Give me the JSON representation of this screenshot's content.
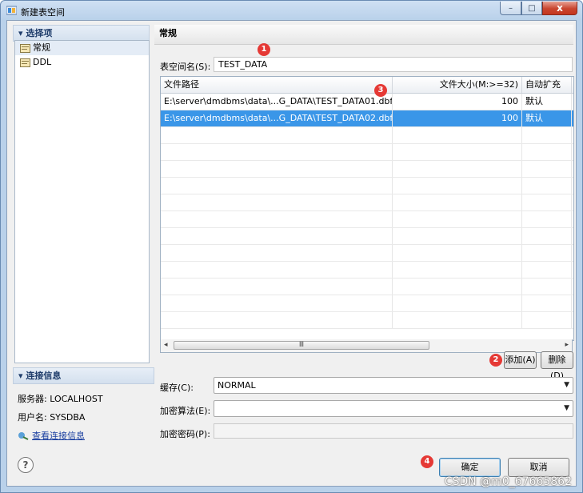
{
  "window": {
    "title": "新建表空间",
    "minimize": "–",
    "maximize": "□",
    "close": "x"
  },
  "left": {
    "options_header": "选择项",
    "tree": [
      {
        "label": "常规"
      },
      {
        "label": "DDL"
      }
    ],
    "conn_header": "连接信息",
    "server": "服务器: LOCALHOST",
    "user": "用户名: SYSDBA",
    "view_link": "查看连接信息"
  },
  "right": {
    "header": "常规",
    "tablespace_label": "表空间名(S):",
    "tablespace_value": "TEST_DATA",
    "table": {
      "columns": [
        "文件路径",
        "文件大小(M:>=32)",
        "自动扩充"
      ],
      "rows": [
        [
          "E:\\server\\dmdbms\\data\\...G_DATA\\TEST_DATA01.dbf",
          "100",
          "默认"
        ],
        [
          "E:\\server\\dmdbms\\data\\...G_DATA\\TEST_DATA02.dbf",
          "100",
          "默认"
        ]
      ],
      "selected_row": 1
    },
    "add_button": "添加(A)",
    "delete_button": "删除(D)",
    "cache_label": "缓存(C):",
    "cache_value": "NORMAL",
    "encrypt_algo_label": "加密算法(E):",
    "encrypt_algo_value": "",
    "encrypt_pwd_label": "加密密码(P):",
    "encrypt_pwd_value": ""
  },
  "footer": {
    "help": "?",
    "ok": "确定",
    "cancel": "取消"
  },
  "badges": [
    "1",
    "2",
    "3",
    "4"
  ],
  "watermark": "CSDN @m0_67665862",
  "colors": {
    "selection": "#3a96e8",
    "badge": "#e53935",
    "link": "#1a3fa0"
  }
}
